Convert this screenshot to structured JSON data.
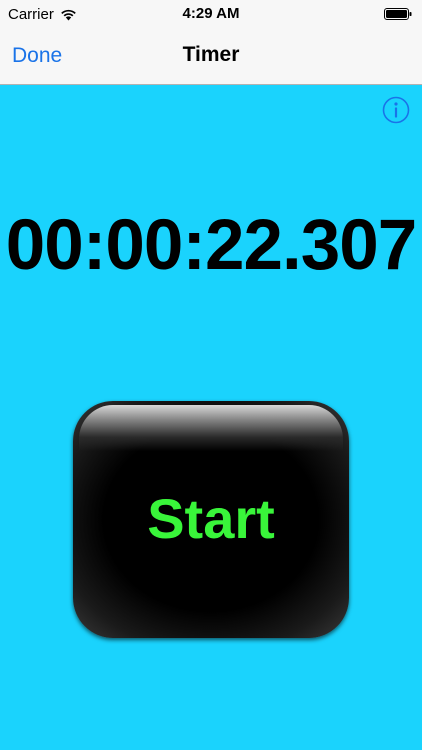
{
  "status_bar": {
    "carrier": "Carrier",
    "time": "4:29 AM",
    "wifi_icon": "wifi-icon",
    "battery_icon": "battery-icon"
  },
  "nav_bar": {
    "done_label": "Done",
    "title": "Timer"
  },
  "info_icon": "info-icon",
  "timer": {
    "display": "00:00:22.307"
  },
  "start_button": {
    "label": "Start"
  },
  "colors": {
    "background": "#1ad3fd",
    "nav_bar": "#f7f7f7",
    "tint": "#1a73e8",
    "start_text": "#39f53a",
    "start_button": "#000000"
  }
}
